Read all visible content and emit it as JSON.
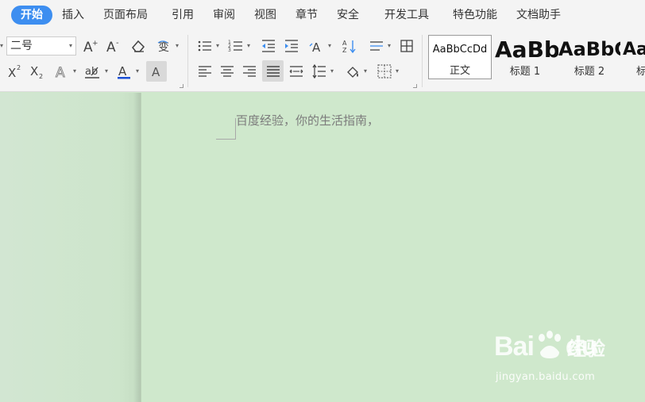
{
  "menu": {
    "items": [
      {
        "label": "开始",
        "active": true
      },
      {
        "label": "插入"
      },
      {
        "label": "页面布局"
      },
      {
        "label": "引用"
      },
      {
        "label": "审阅"
      },
      {
        "label": "视图"
      },
      {
        "label": "章节"
      },
      {
        "label": "安全"
      },
      {
        "label": "开发工具"
      },
      {
        "label": "特色功能"
      },
      {
        "label": "文档助手"
      }
    ]
  },
  "ribbon": {
    "font_size": "二号",
    "styles": [
      {
        "sample": "AaBbCcDd",
        "name": "正文"
      },
      {
        "sample": "AaBb",
        "name": "标题 1"
      },
      {
        "sample": "AaBbC",
        "name": "标题 2"
      },
      {
        "sample": "Aa",
        "name": "标"
      }
    ],
    "icons": {
      "grow_font": "A⁺",
      "shrink_font": "A⁻",
      "text_a": "A",
      "superscript": "X²",
      "subscript": "X₂"
    },
    "colors": {
      "font_color": "#1a4fd6",
      "accent": "#3d8ef0"
    }
  },
  "document": {
    "text": "百度经验，你的生活指南，"
  },
  "watermark": {
    "logo": "Bai",
    "logo2": "du",
    "cn": "经验",
    "url": "jingyan.baidu.com"
  }
}
